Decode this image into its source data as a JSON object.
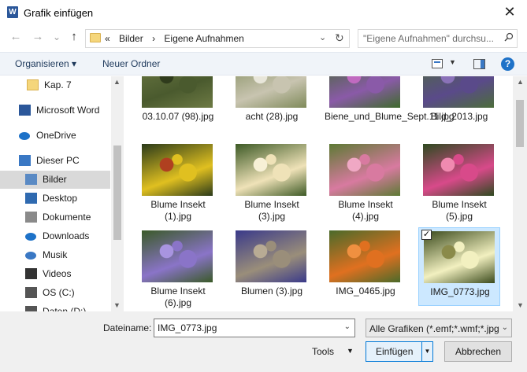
{
  "window": {
    "title": "Grafik einfügen",
    "close": "✕"
  },
  "nav": {
    "back": "←",
    "forward": "→",
    "recent": "⌄",
    "up": "↑",
    "breadcrumb": [
      "«",
      "Bilder",
      "›",
      "Eigene Aufnahmen"
    ],
    "address_dropdown": "⌄",
    "refresh": "↻",
    "search_placeholder": "\"Eigene Aufnahmen\" durchsu...",
    "search_icon": "search-icon"
  },
  "toolbar": {
    "organize": "Organisieren ▾",
    "new_folder": "Neuer Ordner",
    "view_dropdown": "▼",
    "help": "?"
  },
  "sidebar": {
    "items": [
      {
        "label": "Kap. 7",
        "icon": "folder-icon"
      },
      {
        "label": "Microsoft Word",
        "icon": "word-icon"
      },
      {
        "label": "OneDrive",
        "icon": "cloud-icon"
      },
      {
        "label": "Dieser PC",
        "icon": "computer-icon"
      },
      {
        "label": "Bilder",
        "icon": "pictures-icon",
        "selected": true
      },
      {
        "label": "Desktop",
        "icon": "desktop-icon"
      },
      {
        "label": "Dokumente",
        "icon": "documents-icon"
      },
      {
        "label": "Downloads",
        "icon": "download-icon"
      },
      {
        "label": "Musik",
        "icon": "music-icon"
      },
      {
        "label": "Videos",
        "icon": "video-icon"
      },
      {
        "label": "OS (C:)",
        "icon": "drive-icon"
      },
      {
        "label": "Daten (D:)",
        "icon": "drive-icon"
      }
    ],
    "scroll_up": "▲",
    "scroll_down": "▼"
  },
  "files": [
    {
      "name": "03.10.07 (98).jpg",
      "palette": [
        "#4a5a2e",
        "#6d7a44",
        "#2f3b1c"
      ]
    },
    {
      "name": "acht (28).jpg",
      "palette": [
        "#c8c4b0",
        "#7f8a5a",
        "#e8e6da"
      ]
    },
    {
      "name": "Biene_und_Blume_Sept.11.jpg",
      "palette": [
        "#8a5aa8",
        "#3e6b2c",
        "#c06ac0"
      ]
    },
    {
      "name": "Bild_2013.jpg",
      "palette": [
        "#5a4a8a",
        "#4c6d3a",
        "#8a72b8"
      ]
    },
    {
      "name": "Blume Insekt (1).jpg",
      "palette": [
        "#e0c020",
        "#2a3a1a",
        "#b04020"
      ]
    },
    {
      "name": "Blume Insekt (3).jpg",
      "palette": [
        "#efe2b8",
        "#3d5a26",
        "#f7f0d6"
      ]
    },
    {
      "name": "Blume Insekt (4).jpg",
      "palette": [
        "#d87aa0",
        "#5d7a34",
        "#f0a8c4"
      ]
    },
    {
      "name": "Blume Insekt (5).jpg",
      "palette": [
        "#d84a8a",
        "#2e4a20",
        "#f08ab0"
      ]
    },
    {
      "name": "Blume Insekt (6).jpg",
      "palette": [
        "#8a74c8",
        "#3a5a28",
        "#a894e0"
      ]
    },
    {
      "name": "Blumen (3).jpg",
      "palette": [
        "#9a8e7a",
        "#3a3a8a",
        "#b8ab94"
      ]
    },
    {
      "name": "IMG_0465.jpg",
      "palette": [
        "#e07020",
        "#4a6a2a",
        "#f09040"
      ]
    },
    {
      "name": "IMG_0773.jpg",
      "palette": [
        "#f2f0c0",
        "#3a4a1c",
        "#8a8a4a"
      ],
      "selected": true,
      "checked": "✓"
    }
  ],
  "content_scroll": {
    "up": "▲",
    "down": "▼"
  },
  "bottom": {
    "filename_label": "Dateiname:",
    "filename_value": "IMG_0773.jpg",
    "filename_dropdown": "⌄",
    "filter_value": "Alle Grafiken (*.emf;*.wmf;*.jpg",
    "filter_dropdown": "⌄",
    "tools_label": "Tools",
    "tools_dropdown": "▼",
    "insert_label": "Einfügen",
    "insert_dropdown": "▼",
    "cancel_label": "Abbrechen"
  }
}
